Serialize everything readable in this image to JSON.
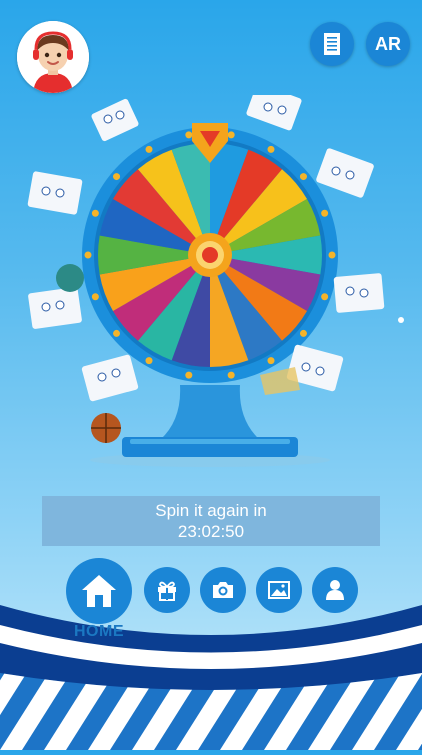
{
  "header": {
    "avatar_icon": "boy-avatar-icon",
    "document_button_icon": "document-icon",
    "ar_button_label": "AR"
  },
  "wheel": {
    "segment_colors": [
      "#1f9be0",
      "#e43a27",
      "#f7c11b",
      "#77b82f",
      "#2bb9b2",
      "#8a3aa0",
      "#f27a16",
      "#2d79c5",
      "#f5a623",
      "#3f4aa4",
      "#29b6a3",
      "#c02d7a",
      "#f9a11b",
      "#55b343",
      "#1f66c2",
      "#e23a34",
      "#f6c21b",
      "#3bbbb1"
    ],
    "rim_color": "#1b8fdc",
    "pointer_color": "#f4a41c",
    "hub_color": "#f4a41c"
  },
  "timer": {
    "line1": "Spin it again in",
    "line2": "23:02:50"
  },
  "nav": {
    "home_label": "HOME",
    "items": [
      {
        "icon": "home-icon"
      },
      {
        "icon": "gift-icon"
      },
      {
        "icon": "camera-icon"
      },
      {
        "icon": "image-icon"
      },
      {
        "icon": "profile-icon"
      }
    ]
  },
  "colors": {
    "accent": "#1b86d6",
    "navy": "#0b3e91"
  }
}
